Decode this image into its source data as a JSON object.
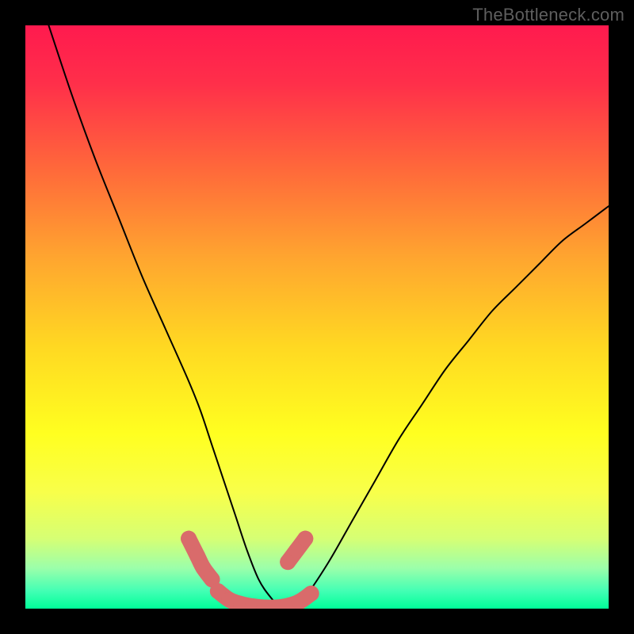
{
  "watermark": "TheBottleneck.com",
  "chart_data": {
    "type": "line",
    "title": "",
    "xlabel": "",
    "ylabel": "",
    "xlim": [
      0,
      100
    ],
    "ylim": [
      0,
      100
    ],
    "grid": false,
    "series": [
      {
        "name": "bottleneck-curve",
        "x": [
          4,
          8,
          12,
          16,
          20,
          24,
          28,
          30,
          32,
          34,
          36,
          38,
          40,
          42,
          44,
          46,
          48,
          52,
          56,
          60,
          64,
          68,
          72,
          76,
          80,
          84,
          88,
          92,
          96,
          100
        ],
        "y": [
          100,
          88,
          77,
          67,
          57,
          48,
          39,
          34,
          28,
          22,
          16,
          10,
          5,
          2,
          0,
          0,
          2,
          8,
          15,
          22,
          29,
          35,
          41,
          46,
          51,
          55,
          59,
          63,
          66,
          69
        ]
      }
    ],
    "highlight_segments": [
      {
        "x": [
          28,
          29.5,
          30.5,
          32
        ],
        "y": [
          12,
          9,
          7,
          5
        ]
      },
      {
        "x": [
          33,
          35,
          37,
          39,
          41,
          43,
          45,
          47,
          49
        ],
        "y": [
          3,
          1.5,
          0.8,
          0.4,
          0.2,
          0.2,
          0.5,
          1.2,
          2.6
        ]
      },
      {
        "x": [
          45,
          46.5,
          48
        ],
        "y": [
          8,
          10,
          12
        ]
      }
    ],
    "gradient_stops": [
      {
        "offset": 0.0,
        "color": "#ff1a4e"
      },
      {
        "offset": 0.1,
        "color": "#ff2f4a"
      },
      {
        "offset": 0.25,
        "color": "#ff6a3a"
      },
      {
        "offset": 0.4,
        "color": "#ffa62f"
      },
      {
        "offset": 0.55,
        "color": "#ffd822"
      },
      {
        "offset": 0.7,
        "color": "#ffff20"
      },
      {
        "offset": 0.8,
        "color": "#f8ff4a"
      },
      {
        "offset": 0.88,
        "color": "#d6ff74"
      },
      {
        "offset": 0.93,
        "color": "#9cffaa"
      },
      {
        "offset": 0.97,
        "color": "#42ffb4"
      },
      {
        "offset": 1.0,
        "color": "#00ff99"
      }
    ]
  }
}
